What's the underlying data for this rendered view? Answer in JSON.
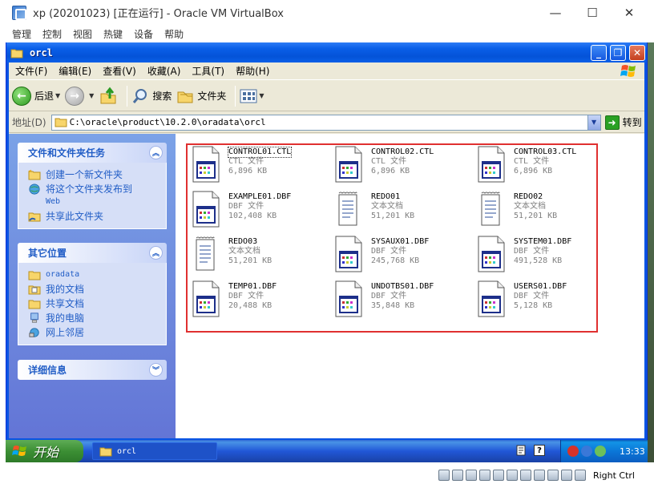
{
  "host": {
    "title": "xp (20201023) [正在运行] - Oracle VM VirtualBox",
    "menu": [
      "管理",
      "控制",
      "视图",
      "热键",
      "设备",
      "帮助"
    ],
    "controls": {
      "minimize": "—",
      "maximize": "☐",
      "close": "✕"
    },
    "status": {
      "host_key": "Right Ctrl"
    }
  },
  "window": {
    "title": "orcl",
    "menu": [
      "文件(F)",
      "编辑(E)",
      "查看(V)",
      "收藏(A)",
      "工具(T)",
      "帮助(H)"
    ],
    "toolbar": {
      "back": "后退",
      "search": "搜索",
      "folders": "文件夹"
    },
    "address": {
      "label": "地址(D)",
      "path": "C:\\oracle\\product\\10.2.0\\oradata\\orcl",
      "go": "转到"
    }
  },
  "taskpane": {
    "tasks": {
      "title": "文件和文件夹任务",
      "links": [
        "创建一个新文件夹",
        "将这个文件夹发布到",
        "Web",
        "共享此文件夹"
      ]
    },
    "places": {
      "title": "其它位置",
      "links": [
        "oradata",
        "我的文档",
        "共享文档",
        "我的电脑",
        "网上邻居"
      ]
    },
    "details": {
      "title": "详细信息"
    }
  },
  "files": [
    {
      "name": "CONTROL01.CTL",
      "type": "CTL 文件",
      "size": "6,896 KB",
      "icon": "ctl-file-icon"
    },
    {
      "name": "CONTROL02.CTL",
      "type": "CTL 文件",
      "size": "6,896 KB",
      "icon": "ctl-file-icon"
    },
    {
      "name": "CONTROL03.CTL",
      "type": "CTL 文件",
      "size": "6,896 KB",
      "icon": "ctl-file-icon"
    },
    {
      "name": "EXAMPLE01.DBF",
      "type": "DBF 文件",
      "size": "102,408 KB",
      "icon": "dbf-file-icon"
    },
    {
      "name": "REDO01",
      "type": "文本文档",
      "size": "51,201 KB",
      "icon": "text-document-icon"
    },
    {
      "name": "REDO02",
      "type": "文本文档",
      "size": "51,201 KB",
      "icon": "text-document-icon"
    },
    {
      "name": "REDO03",
      "type": "文本文档",
      "size": "51,201 KB",
      "icon": "text-document-icon"
    },
    {
      "name": "SYSAUX01.DBF",
      "type": "DBF 文件",
      "size": "245,768 KB",
      "icon": "dbf-file-icon"
    },
    {
      "name": "SYSTEM01.DBF",
      "type": "DBF 文件",
      "size": "491,528 KB",
      "icon": "dbf-file-icon"
    },
    {
      "name": "TEMP01.DBF",
      "type": "DBF 文件",
      "size": "20,488 KB",
      "icon": "dbf-file-icon"
    },
    {
      "name": "UNDOTBS01.DBF",
      "type": "DBF 文件",
      "size": "35,848 KB",
      "icon": "dbf-file-icon"
    },
    {
      "name": "USERS01.DBF",
      "type": "DBF 文件",
      "size": "5,128 KB",
      "icon": "dbf-file-icon"
    }
  ],
  "taskbar": {
    "start": "开始",
    "task": "orcl",
    "clock": "13:33"
  },
  "colors": {
    "xp_blue": "#0a54e3",
    "selection_outline": "#e03030",
    "taskpane_link": "#215dc6"
  }
}
